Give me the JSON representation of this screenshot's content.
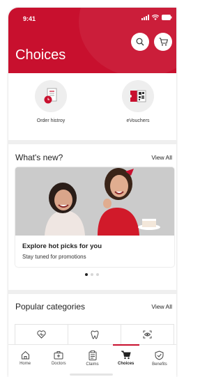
{
  "status_bar": {
    "time": "9:41"
  },
  "header": {
    "title": "Choices",
    "bg_color": "#c8102e"
  },
  "quick_links": [
    {
      "label": "Order histroy",
      "icon": "receipt-clock-icon"
    },
    {
      "label": "eVouchers",
      "icon": "voucher-qr-icon"
    }
  ],
  "whats_new": {
    "title": "What's new?",
    "view_all": "View All",
    "promo": {
      "heading": "Explore hot picks for you",
      "subtitle": "Stay tuned for promotions"
    },
    "carousel": {
      "current_page": 1,
      "total_pages": 3
    }
  },
  "popular": {
    "title": "Popular categories",
    "view_all": "View All",
    "categories": [
      {
        "icon": "heart-icon"
      },
      {
        "icon": "tooth-icon"
      },
      {
        "icon": "eye-scan-icon"
      }
    ]
  },
  "tabbar": {
    "items": [
      {
        "label": "Home",
        "icon": "home-icon"
      },
      {
        "label": "Doctors",
        "icon": "medical-kit-icon"
      },
      {
        "label": "Claims",
        "icon": "clipboard-icon"
      },
      {
        "label": "Choices",
        "icon": "cart-icon",
        "active": true
      },
      {
        "label": "Benefits",
        "icon": "shield-check-icon"
      }
    ]
  }
}
